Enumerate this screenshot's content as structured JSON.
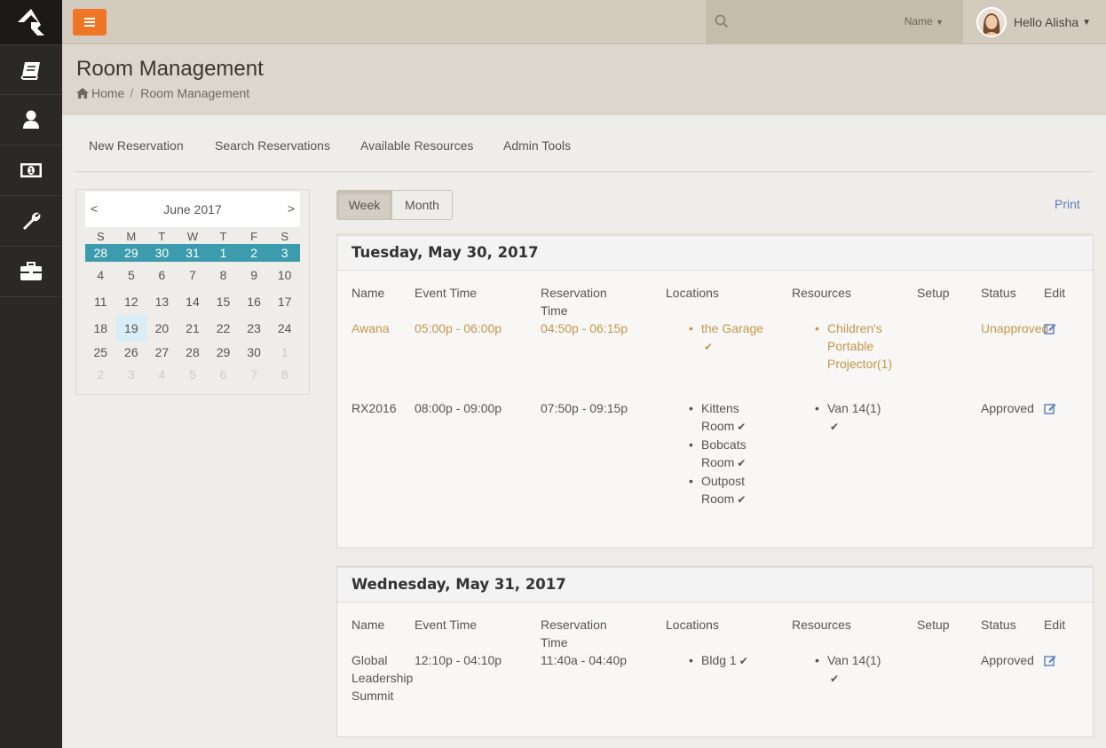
{
  "header": {
    "search_filter": "Name",
    "user_greeting": "Hello Alisha"
  },
  "page": {
    "title": "Room Management",
    "breadcrumb": [
      "Home",
      "Room Management"
    ]
  },
  "subnav": [
    "New Reservation",
    "Search Reservations",
    "Available Resources",
    "Admin Tools"
  ],
  "calendar": {
    "title": "June 2017",
    "prev": "<",
    "next": ">",
    "days_of_week": [
      "S",
      "M",
      "T",
      "W",
      "T",
      "F",
      "S"
    ],
    "weeks": [
      [
        "28",
        "29",
        "30",
        "31",
        "1",
        "2",
        "3"
      ],
      [
        "4",
        "5",
        "6",
        "7",
        "8",
        "9",
        "10"
      ],
      [
        "11",
        "12",
        "13",
        "14",
        "15",
        "16",
        "17"
      ],
      [
        "18",
        "19",
        "20",
        "21",
        "22",
        "23",
        "24"
      ],
      [
        "25",
        "26",
        "27",
        "28",
        "29",
        "30",
        "1"
      ],
      [
        "2",
        "3",
        "4",
        "5",
        "6",
        "7",
        "8"
      ]
    ]
  },
  "view": {
    "week_label": "Week",
    "month_label": "Month",
    "print_label": "Print"
  },
  "table_headers": [
    "Name",
    "Event Time",
    "Reservation Time",
    "Locations",
    "Resources",
    "Setup",
    "Status",
    "Edit"
  ],
  "days": [
    {
      "date": "Tuesday, May 30, 2017",
      "rows": [
        {
          "name": "Awana",
          "event_time": "05:00p - 06:00p",
          "reservation_time": "04:50p - 06:15p",
          "locations": [
            "the Garage"
          ],
          "resources": [
            "Children's Portable Projector(1)"
          ],
          "setup": "",
          "status": "Unapproved"
        },
        {
          "name": "RX2016",
          "event_time": "08:00p - 09:00p",
          "reservation_time": "07:50p - 09:15p",
          "locations": [
            "Kittens Room",
            "Bobcats Room",
            "Outpost Room"
          ],
          "resources": [
            "Van 14(1)"
          ],
          "setup": "",
          "status": "Approved"
        }
      ]
    },
    {
      "date": "Wednesday, May 31, 2017",
      "rows": [
        {
          "name": "Global Leadership Summit",
          "event_time": "12:10p - 04:10p",
          "reservation_time": "11:40a - 04:40p",
          "locations": [
            "Bldg 1"
          ],
          "resources": [
            "Van 14(1)"
          ],
          "setup": "",
          "status": "Approved"
        }
      ]
    }
  ],
  "colors": {
    "accent_orange": "#ee7625",
    "selected_week": "#3c9bad",
    "today": "#d9edf7",
    "unapproved": "#c2974e",
    "link": "#5b7fbd"
  }
}
